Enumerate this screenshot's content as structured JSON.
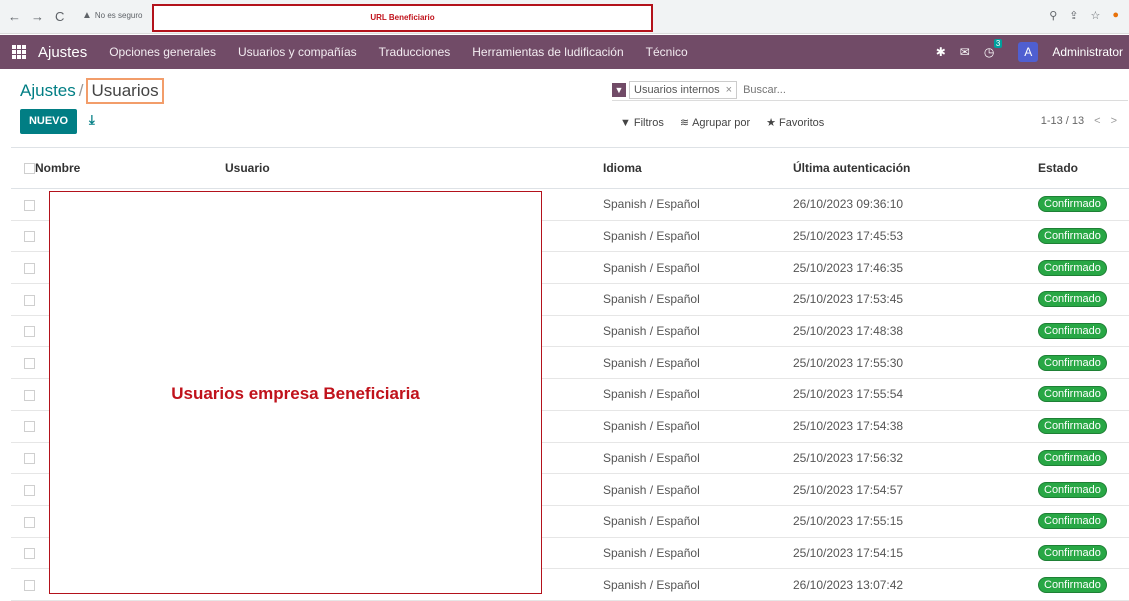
{
  "browser": {
    "back": "←",
    "forward": "→",
    "reload": "C",
    "security_label": "No es seguro",
    "url_annotation": "URL Beneficiario"
  },
  "navbar": {
    "app_name": "Ajustes",
    "menu": [
      {
        "label": "Opciones generales"
      },
      {
        "label": "Usuarios y compañías"
      },
      {
        "label": "Traducciones"
      },
      {
        "label": "Herramientas de ludificación"
      },
      {
        "label": "Técnico"
      }
    ],
    "activity_count": "3",
    "avatar_letter": "A",
    "user_name": "Administrator"
  },
  "breadcrumb": {
    "parent": "Ajustes",
    "separator": "/",
    "current": "Usuarios"
  },
  "actions": {
    "new_label": "NUEVO"
  },
  "search": {
    "facet_label": "Usuarios internos",
    "facet_remove": "×",
    "placeholder": "Buscar..."
  },
  "control_options": {
    "filters": "Filtros",
    "group_by": "Agrupar por",
    "favorites": "Favoritos"
  },
  "pager": {
    "range": "1-13 / 13",
    "prev": "<",
    "next": ">"
  },
  "table": {
    "headers": {
      "name": "Nombre",
      "user": "Usuario",
      "language": "Idioma",
      "last_auth": "Última autenticación",
      "status": "Estado"
    },
    "rows": [
      {
        "language": "Spanish / Español",
        "last_auth": "26/10/2023 09:36:10",
        "status": "Confirmado"
      },
      {
        "language": "Spanish / Español",
        "last_auth": "25/10/2023 17:45:53",
        "status": "Confirmado"
      },
      {
        "language": "Spanish / Español",
        "last_auth": "25/10/2023 17:46:35",
        "status": "Confirmado"
      },
      {
        "language": "Spanish / Español",
        "last_auth": "25/10/2023 17:53:45",
        "status": "Confirmado"
      },
      {
        "language": "Spanish / Español",
        "last_auth": "25/10/2023 17:48:38",
        "status": "Confirmado"
      },
      {
        "language": "Spanish / Español",
        "last_auth": "25/10/2023 17:55:30",
        "status": "Confirmado"
      },
      {
        "language": "Spanish / Español",
        "last_auth": "25/10/2023 17:55:54",
        "status": "Confirmado"
      },
      {
        "language": "Spanish / Español",
        "last_auth": "25/10/2023 17:54:38",
        "status": "Confirmado"
      },
      {
        "language": "Spanish / Español",
        "last_auth": "25/10/2023 17:56:32",
        "status": "Confirmado"
      },
      {
        "language": "Spanish / Español",
        "last_auth": "25/10/2023 17:54:57",
        "status": "Confirmado"
      },
      {
        "language": "Spanish / Español",
        "last_auth": "25/10/2023 17:55:15",
        "status": "Confirmado"
      },
      {
        "language": "Spanish / Español",
        "last_auth": "25/10/2023 17:54:15",
        "status": "Confirmado"
      },
      {
        "language": "Spanish / Español",
        "last_auth": "26/10/2023 13:07:42",
        "status": "Confirmado"
      }
    ]
  },
  "annotation": {
    "label": "Usuarios empresa Beneficiaria"
  },
  "colors": {
    "navbar": "#714b67",
    "primary": "#017e84",
    "annotation_red": "#b3121b",
    "highlight_orange": "#f29d6a",
    "status_green": "#28a745"
  },
  "icons": {
    "apps": "apps-grid-icon",
    "filter": "filter-icon",
    "group": "layers-icon",
    "favorite": "star-icon",
    "download": "download-icon",
    "bug": "bug-icon",
    "chat": "chat-icon",
    "clock": "clock-icon"
  }
}
